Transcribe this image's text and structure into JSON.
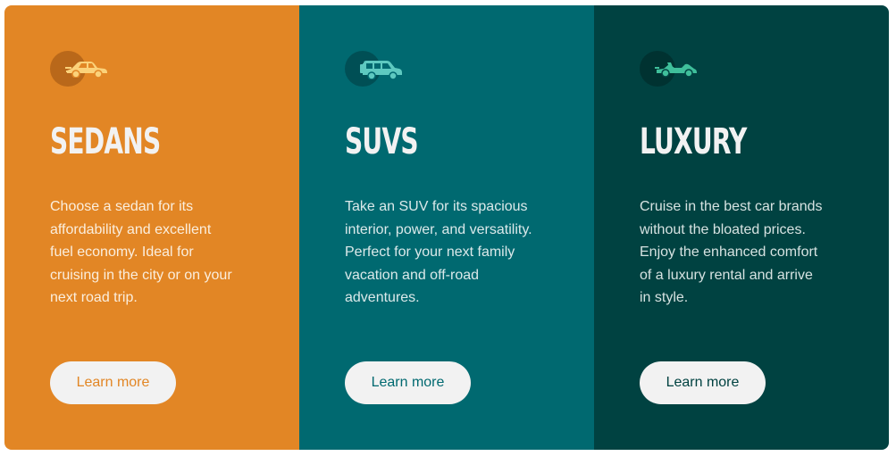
{
  "colors": {
    "sedans": "#e28625",
    "suvs": "#006970",
    "luxury": "#004241",
    "button_bg": "#f2f2f2",
    "title": "#f2f2f2"
  },
  "cards": [
    {
      "icon": "sedan-car-icon",
      "title": "SEDANS",
      "text": "Choose a sedan for its affordability and excellent fuel economy. Ideal for cruising in the city or on your next road trip.",
      "button_label": "Learn more"
    },
    {
      "icon": "suv-car-icon",
      "title": "SUVS",
      "text": "Take an SUV for its spacious interior, power, and versatility. Perfect for your next family vacation and off-road adventures.",
      "button_label": "Learn more"
    },
    {
      "icon": "luxury-car-icon",
      "title": "LUXURY",
      "text": "Cruise in the best car brands without the bloated prices. Enjoy the enhanced comfort of a luxury rental and arrive in style.",
      "button_label": "Learn more"
    }
  ]
}
